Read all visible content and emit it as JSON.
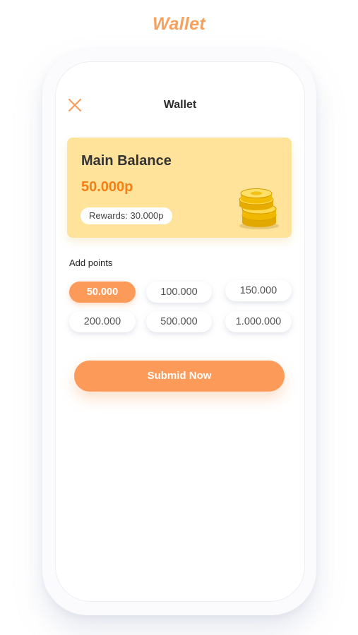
{
  "header": {
    "promo_title": "Wallet"
  },
  "nav": {
    "close_icon": "close-icon",
    "title": "Wallet"
  },
  "balance_card": {
    "label": "Main Balance",
    "value": "50.000p",
    "rewards": "Rewards: 30.000p",
    "illustration": "coins-stack-icon"
  },
  "add_points": {
    "label": "Add points",
    "options": [
      {
        "label": "50.000",
        "selected": true
      },
      {
        "label": "100.000",
        "selected": false
      },
      {
        "label": "150.000",
        "selected": false
      },
      {
        "label": "200.000",
        "selected": false
      },
      {
        "label": "500.000",
        "selected": false
      },
      {
        "label": "1.000.000",
        "selected": false
      }
    ]
  },
  "submit": {
    "label": "Submid Now"
  },
  "colors": {
    "accent": "#fc9a5a",
    "promo_title": "#f7a15f",
    "balance_value": "#f57f17",
    "card_bg": "#ffe39b"
  }
}
